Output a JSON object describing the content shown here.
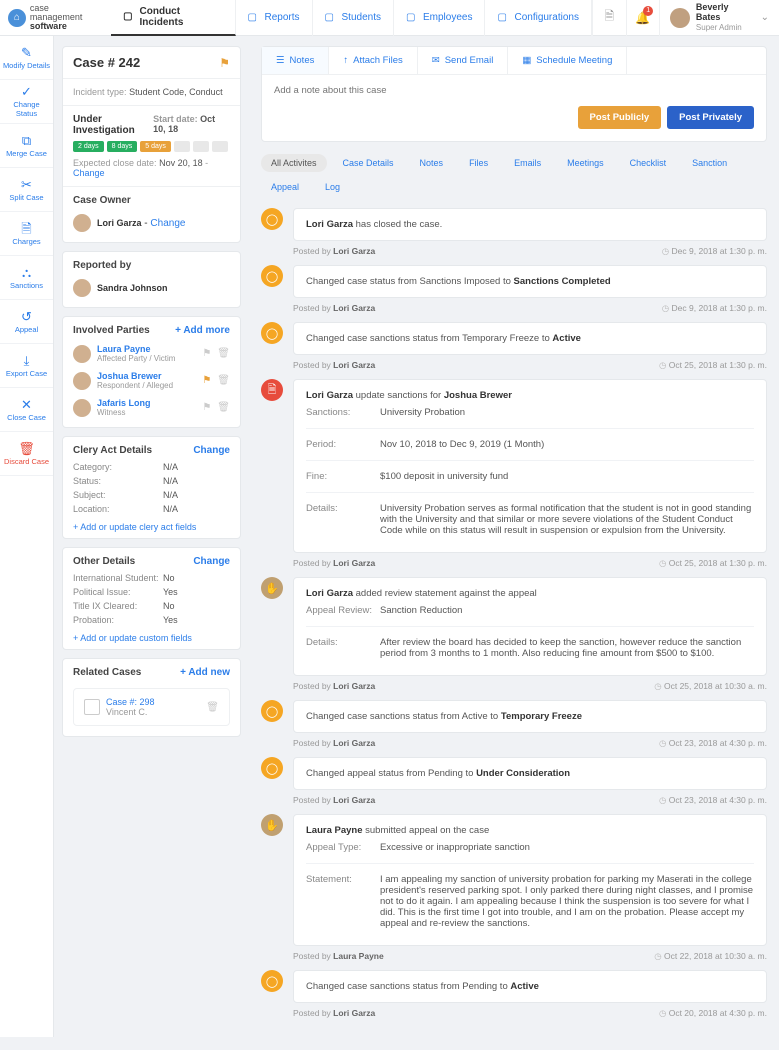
{
  "brand": {
    "line1": "case management",
    "line2": "software"
  },
  "topnav": {
    "items": [
      {
        "label": "Conduct Incidents",
        "active": true
      },
      {
        "label": "Reports"
      },
      {
        "label": "Students"
      },
      {
        "label": "Employees"
      },
      {
        "label": "Configurations"
      }
    ],
    "notif_count": "1",
    "user_name": "Beverly Bates",
    "user_role": "Super Admin"
  },
  "rail": [
    {
      "icon": "✎",
      "label": "Modify Details"
    },
    {
      "icon": "✓",
      "label": "Change Status"
    },
    {
      "icon": "⧉",
      "label": "Merge Case"
    },
    {
      "icon": "✂",
      "label": "Split Case"
    },
    {
      "icon": "🗎",
      "label": "Charges"
    },
    {
      "icon": "⛬",
      "label": "Sanctions"
    },
    {
      "icon": "↺",
      "label": "Appeal"
    },
    {
      "icon": "⤓",
      "label": "Export Case"
    },
    {
      "icon": "✕",
      "label": "Close Case"
    },
    {
      "icon": "🗑",
      "label": "Discard Case",
      "danger": true
    }
  ],
  "case": {
    "number": "Case # 242",
    "type_label": "Incident type:",
    "type_value": "Student Code, Conduct",
    "status": "Under Investigation",
    "start_label": "Start date:",
    "start_date": "Oct 10, 18",
    "pills": [
      "2 days",
      "8 days",
      "5 days"
    ],
    "expected_label": "Expected close date:",
    "expected_date": "Nov 20, 18",
    "change": "Change",
    "owner_head": "Case Owner",
    "owner_name": "Lori Garza",
    "reported_head": "Reported by",
    "reported_name": "Sandra Johnson",
    "parties_head": "Involved Parties",
    "add_more": "+ Add more",
    "parties": [
      {
        "name": "Laura Payne",
        "role": "Affected Party / Victim",
        "flag": false
      },
      {
        "name": "Joshua Brewer",
        "role": "Respondent / Alleged",
        "flag": true
      },
      {
        "name": "Jafaris Long",
        "role": "Witness",
        "flag": false
      }
    ],
    "clery_head": "Clery Act Details",
    "clery": [
      {
        "k": "Category:",
        "v": "N/A"
      },
      {
        "k": "Status:",
        "v": "N/A"
      },
      {
        "k": "Subject:",
        "v": "N/A"
      },
      {
        "k": "Location:",
        "v": "N/A"
      }
    ],
    "clery_link": "+ Add or update clery act fields",
    "other_head": "Other Details",
    "other": [
      {
        "k": "International Student:",
        "v": "No"
      },
      {
        "k": "Political Issue:",
        "v": "Yes"
      },
      {
        "k": "Title IX Cleared:",
        "v": "No"
      },
      {
        "k": "Probation:",
        "v": "Yes"
      }
    ],
    "custom_link": "+ Add or update custom fields",
    "related_head": "Related Cases",
    "add_new": "+ Add new",
    "related": {
      "title": "Case #: 298",
      "sub": "Vincent C."
    }
  },
  "compose": {
    "tabs": [
      {
        "icon": "☰",
        "label": "Notes",
        "active": true
      },
      {
        "icon": "↑",
        "label": "Attach Files"
      },
      {
        "icon": "✉",
        "label": "Send Email"
      },
      {
        "icon": "▦",
        "label": "Schedule Meeting"
      }
    ],
    "placeholder": "Add a note about this case",
    "btn_public": "Post Publicly",
    "btn_private": "Post Privately"
  },
  "filters": [
    "All Activites",
    "Case Details",
    "Notes",
    "Files",
    "Emails",
    "Meetings",
    "Checklist",
    "Sanction",
    "Appeal",
    "Log"
  ],
  "posted_by": "Posted by",
  "feed": [
    {
      "ico": "orange",
      "glyph": "◯",
      "textA": "Lori Garza",
      "textB": " has closed the case.",
      "by": "Lori Garza",
      "time": "Dec 9, 2018 at 1:30 p. m."
    },
    {
      "ico": "orange",
      "glyph": "◯",
      "plain": "Changed case status from Sanctions Imposed to ",
      "bold": "Sanctions Completed",
      "by": "Lori Garza",
      "time": "Dec 9, 2018 at 1:30 p. m."
    },
    {
      "ico": "orange",
      "glyph": "◯",
      "plain": "Changed case sanctions status from Temporary Freeze to ",
      "bold": "Active",
      "by": "Lori Garza",
      "time": "Oct 25, 2018 at 1:30 p. m."
    },
    {
      "ico": "red",
      "glyph": "🗎",
      "titleA": "Lori Garza",
      "titleB": " update sanctions for ",
      "titleC": "Joshua Brewer",
      "rows": [
        {
          "k": "Sanctions:",
          "v": "University Probation"
        },
        {
          "k": "Period:",
          "v": "Nov 10, 2018 to Dec 9, 2019 (1 Month)"
        },
        {
          "k": "Fine:",
          "v": "$100 deposit in university fund"
        },
        {
          "k": "Details:",
          "v": "University Probation serves as formal notification that the student is not in good standing with the University and that similar or more severe violations of the Student Conduct Code while on this status will result in suspension or expulsion from the University."
        }
      ],
      "by": "Lori Garza",
      "time": "Oct 25, 2018 at 1:30 p. m."
    },
    {
      "ico": "tan",
      "glyph": "✋",
      "titleA": "Lori Garza",
      "titleB": " added review statement against the appeal",
      "titleC": "",
      "rows": [
        {
          "k": "Appeal Review:",
          "v": "Sanction Reduction"
        },
        {
          "k": "Details:",
          "v": "After review the board has decided to keep the sanction, however reduce the sanction period from 3 months to 1 month. Also reducing fine amount from $500 to $100."
        }
      ],
      "by": "Lori Garza",
      "time": "Oct 25, 2018 at 10:30 a. m."
    },
    {
      "ico": "orange",
      "glyph": "◯",
      "plain": "Changed case sanctions status from Active to ",
      "bold": "Temporary Freeze",
      "by": "Lori Garza",
      "time": "Oct 23, 2018 at 4:30 p. m."
    },
    {
      "ico": "orange",
      "glyph": "◯",
      "plain": "Changed appeal status from Pending to ",
      "bold": "Under Consideration",
      "by": "Lori Garza",
      "time": "Oct 23, 2018 at 4:30 p. m."
    },
    {
      "ico": "tan",
      "glyph": "✋",
      "titleA": "Laura Payne",
      "titleB": " submitted appeal on the case",
      "titleC": "",
      "rows": [
        {
          "k": "Appeal Type:",
          "v": "Excessive or inappropriate sanction"
        },
        {
          "k": "Statement:",
          "v": "I am appealing my sanction of university probation for parking my Maserati in the college president's reserved parking spot. I only parked there during night classes, and I promise not to do it again. I am appealing because I think the suspension is too severe for what I did. This is the first time I got into trouble, and I am on the probation. Please accept my appeal and re-review the sanctions."
        }
      ],
      "by": "Laura Payne",
      "time": "Oct 22, 2018 at 10:30 a. m."
    },
    {
      "ico": "orange",
      "glyph": "◯",
      "plain": "Changed case sanctions status from Pending to ",
      "bold": "Active",
      "by": "Lori Garza",
      "time": "Oct 20, 2018 at 4:30 p. m."
    }
  ]
}
